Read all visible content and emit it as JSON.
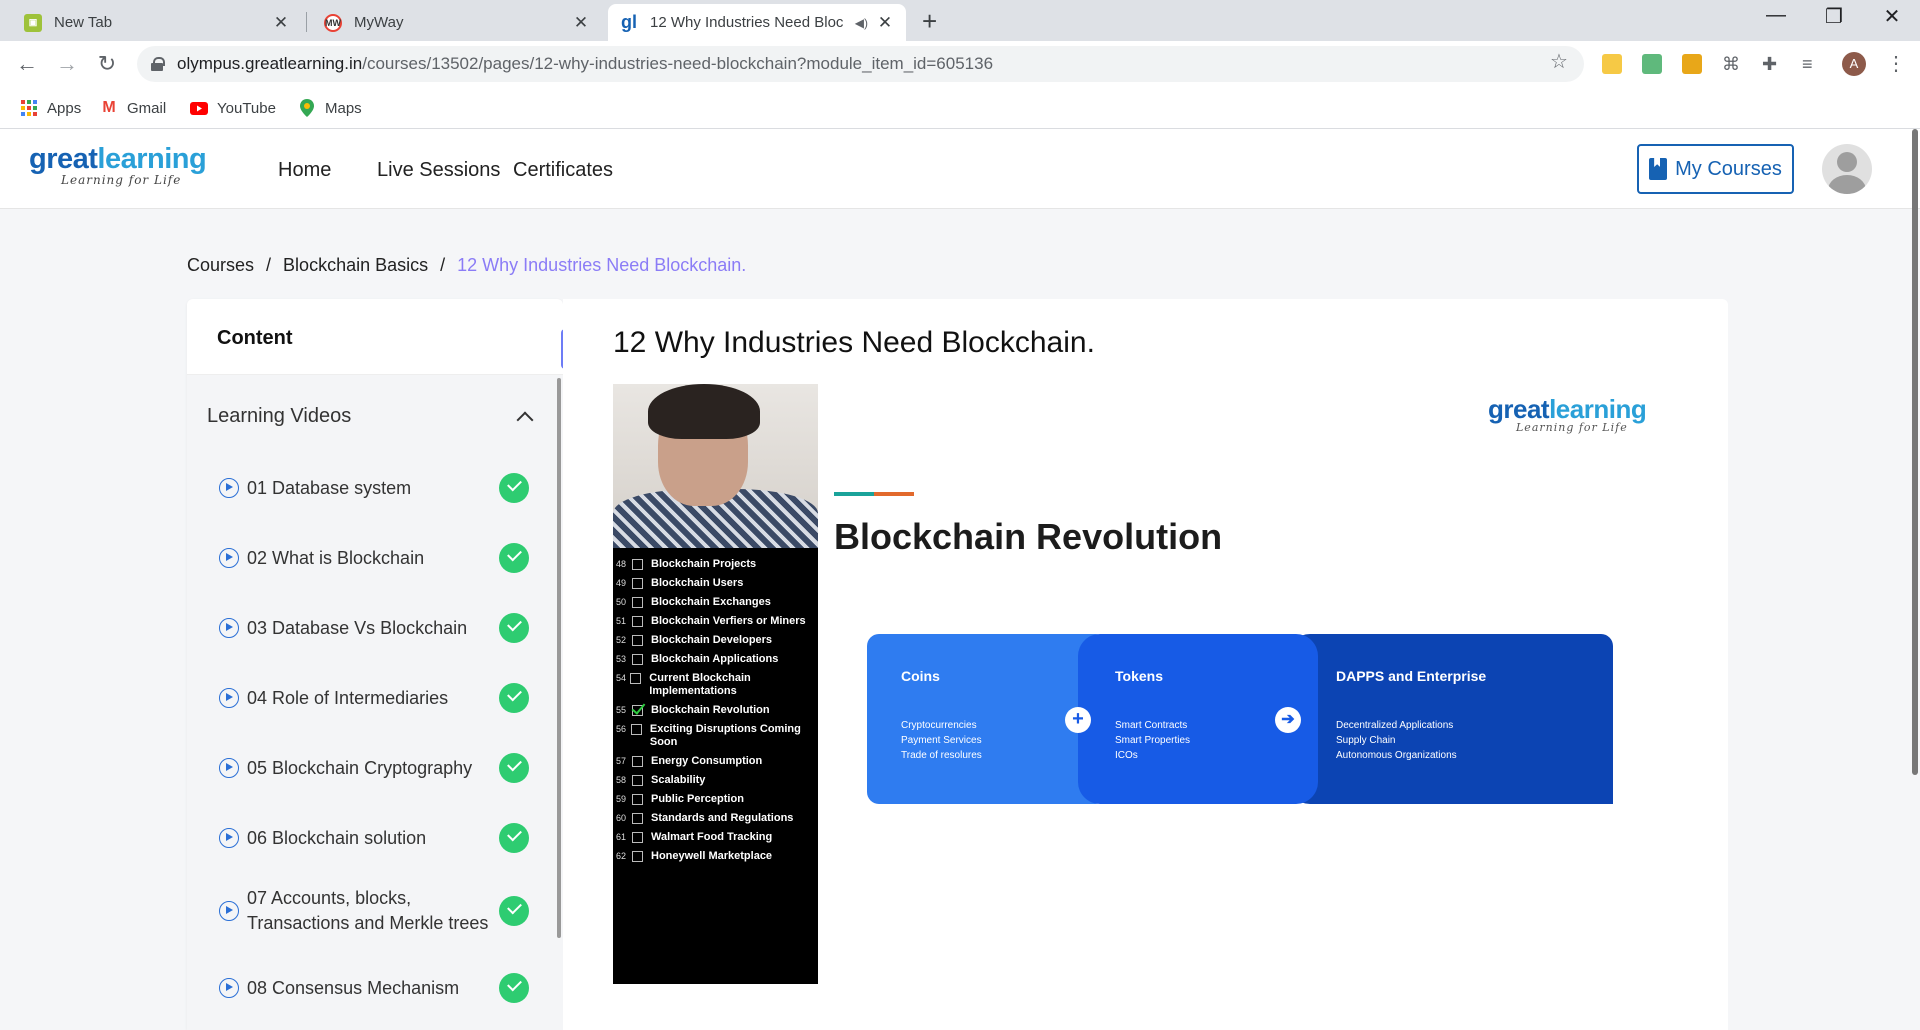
{
  "browser": {
    "tabs": [
      {
        "title": "New Tab",
        "close": "✕"
      },
      {
        "title": "MyWay",
        "close": "✕"
      },
      {
        "title": "12 Why Industries Need Bloc",
        "close": "✕"
      }
    ],
    "new_tab": "+",
    "url_host": "olympus.greatlearning.in",
    "url_path": "/courses/13502/pages/12-why-industries-need-blockchain?module_item_id=605136",
    "profile_initial": "A",
    "bookmarks": [
      "Apps",
      "Gmail",
      "YouTube",
      "Maps"
    ]
  },
  "site": {
    "logo_great": "great",
    "logo_learning": "learning",
    "logo_tag": "Learning for Life",
    "nav": [
      "Home",
      "Live Sessions",
      "Certificates"
    ],
    "my_courses": "My Courses"
  },
  "breadcrumb": {
    "items": [
      "Courses",
      "Blockchain Basics"
    ],
    "separator": "/",
    "current": "12 Why Industries Need Blockchain."
  },
  "sidebar": {
    "title": "Content",
    "section": "Learning Videos",
    "collapse": "«",
    "lessons": [
      "01 Database system",
      "02 What is Blockchain",
      "03 Database Vs Blockchain",
      "04 Role of Intermediaries",
      "05 Blockchain Cryptography",
      "06 Blockchain solution",
      "07 Accounts, blocks, Transactions and Merkle trees",
      "08 Consensus Mechanism"
    ]
  },
  "main": {
    "title": "12 Why Industries Need Blockchain."
  },
  "slide": {
    "title": "Blockchain Revolution",
    "checklist": [
      {
        "n": "48",
        "text": "Blockchain Projects",
        "checked": false
      },
      {
        "n": "49",
        "text": "Blockchain Users",
        "checked": false
      },
      {
        "n": "50",
        "text": "Blockchain Exchanges",
        "checked": false
      },
      {
        "n": "51",
        "text": "Blockchain Verfiers or Miners",
        "checked": false
      },
      {
        "n": "52",
        "text": "Blockchain Developers",
        "checked": false
      },
      {
        "n": "53",
        "text": "Blockchain Applications",
        "checked": false
      },
      {
        "n": "54",
        "text": "Current Blockchain Implementations",
        "checked": false
      },
      {
        "n": "55",
        "text": "Blockchain Revolution",
        "checked": true
      },
      {
        "n": "56",
        "text": "Exciting Disruptions Coming Soon",
        "checked": false
      },
      {
        "n": "57",
        "text": "Energy Consumption",
        "checked": false
      },
      {
        "n": "58",
        "text": "Scalability",
        "checked": false
      },
      {
        "n": "59",
        "text": "Public Perception",
        "checked": false
      },
      {
        "n": "60",
        "text": "Standards and Regulations",
        "checked": false
      },
      {
        "n": "61",
        "text": "Walmart Food Tracking",
        "checked": false
      },
      {
        "n": "62",
        "text": "Honeywell Marketplace",
        "checked": false
      }
    ],
    "flow": [
      {
        "heading": "Coins",
        "lines": [
          "Cryptocurrencies",
          "Payment Services",
          "Trade of resolures"
        ]
      },
      {
        "heading": "Tokens",
        "lines": [
          "Smart Contracts",
          "Smart Properties",
          "ICOs"
        ]
      },
      {
        "heading": "DAPPS and Enterprise",
        "lines": [
          "Decentralized Applications",
          "Supply Chain",
          "Autonomous Organizations"
        ]
      }
    ],
    "plus": "+",
    "arrow": "➔"
  },
  "colors": {
    "brand_blue": "#1662b3",
    "accent_purple": "#8b7cf6",
    "complete_green": "#2ecc71"
  }
}
